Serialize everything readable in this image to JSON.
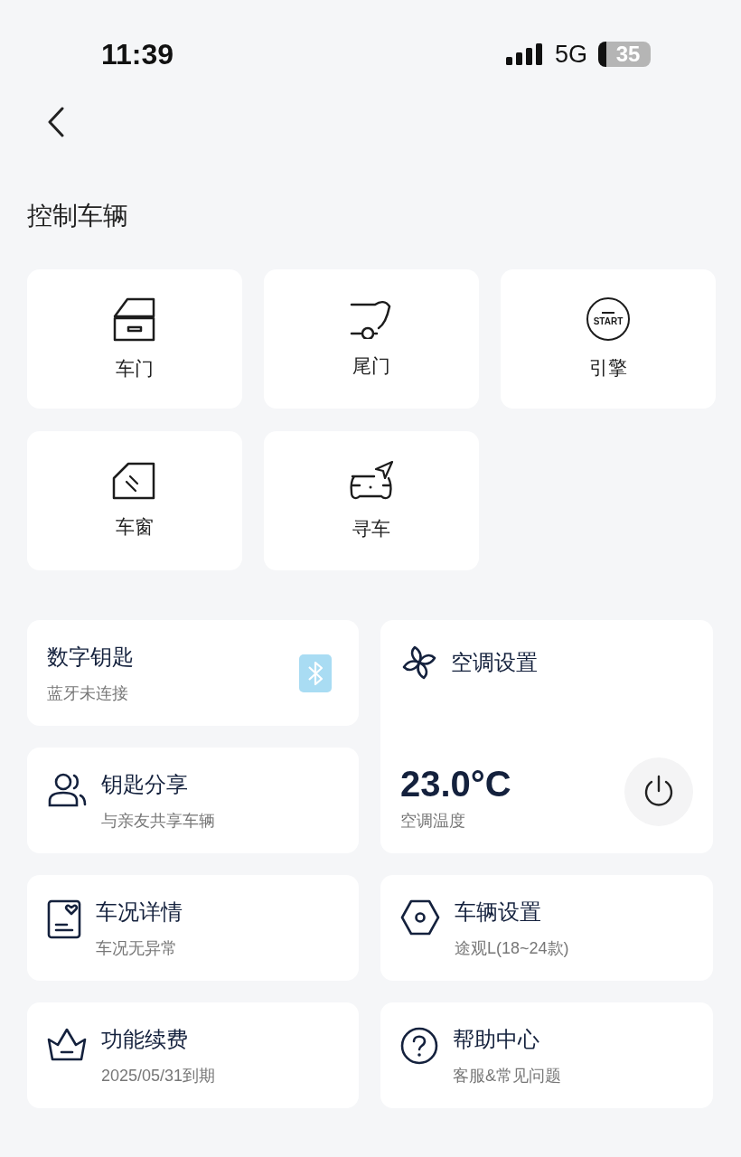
{
  "status_bar": {
    "time": "11:39",
    "network": "5G",
    "battery": "35"
  },
  "section_title": "控制车辆",
  "controls": [
    {
      "kind": "door",
      "label": "车门"
    },
    {
      "kind": "tailgate",
      "label": "尾门"
    },
    {
      "kind": "engine",
      "label": "引擎",
      "icon_text": "START"
    },
    {
      "kind": "window",
      "label": "车窗"
    },
    {
      "kind": "find",
      "label": "寻车"
    }
  ],
  "cards": [
    {
      "kind": "digital_key",
      "title": "数字钥匙",
      "subtitle": "蓝牙未连接"
    },
    {
      "kind": "share",
      "title": "钥匙分享",
      "subtitle": "与亲友共享车辆"
    },
    {
      "kind": "climate",
      "title": "空调设置",
      "temperature": "23.0°C",
      "subtitle": "空调温度"
    },
    {
      "kind": "condition",
      "title": "车况详情",
      "subtitle": "车况无异常"
    },
    {
      "kind": "vehicle_settings",
      "title": "车辆设置",
      "subtitle": "途观L(18~24款)"
    },
    {
      "kind": "renewal",
      "title": "功能续费",
      "subtitle": "2025/05/31到期"
    },
    {
      "kind": "help",
      "title": "帮助中心",
      "subtitle": "客服&常见问题"
    }
  ]
}
